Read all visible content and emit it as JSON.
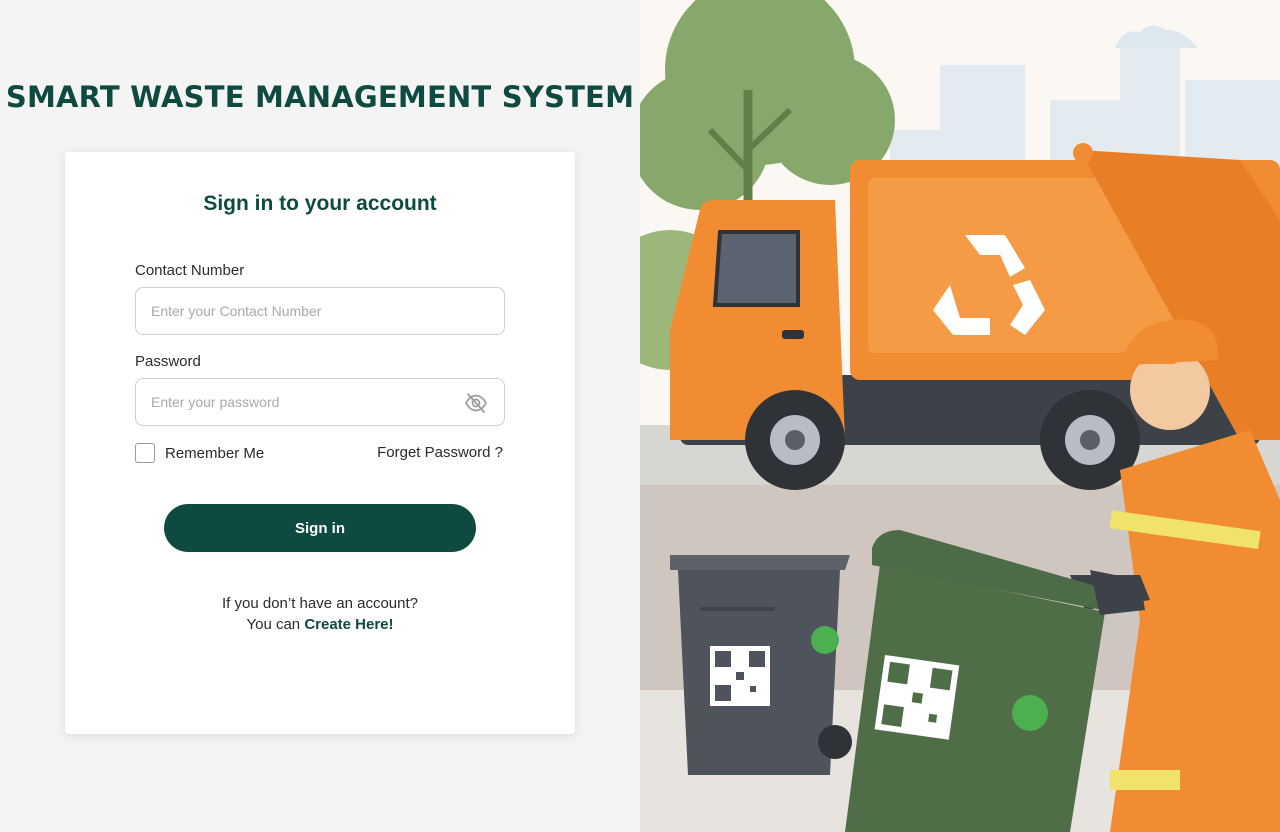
{
  "app": {
    "title": "SMART WASTE MANAGEMENT SYSTEM"
  },
  "login": {
    "heading": "Sign in to your account",
    "contact_label": "Contact Number",
    "contact_placeholder": "Enter your Contact Number",
    "contact_value": "",
    "password_label": "Password",
    "password_placeholder": "Enter your password",
    "password_value": "",
    "remember_label": "Remember Me",
    "remember_checked": false,
    "forgot_label": "Forget Password ?",
    "signin_label": "Sign in",
    "no_account_text": "If you don’t have an account?",
    "you_can_text": "You can",
    "create_link": "Create Here!"
  },
  "icons": {
    "password_toggle": "eye-off-icon",
    "recycle": "recycle-icon",
    "qr": "qr-code-icon"
  },
  "colors": {
    "brand": "#0e4a40",
    "truck": "#f28c32",
    "bin_gray": "#4f545c",
    "bin_green": "#4f6e48"
  }
}
